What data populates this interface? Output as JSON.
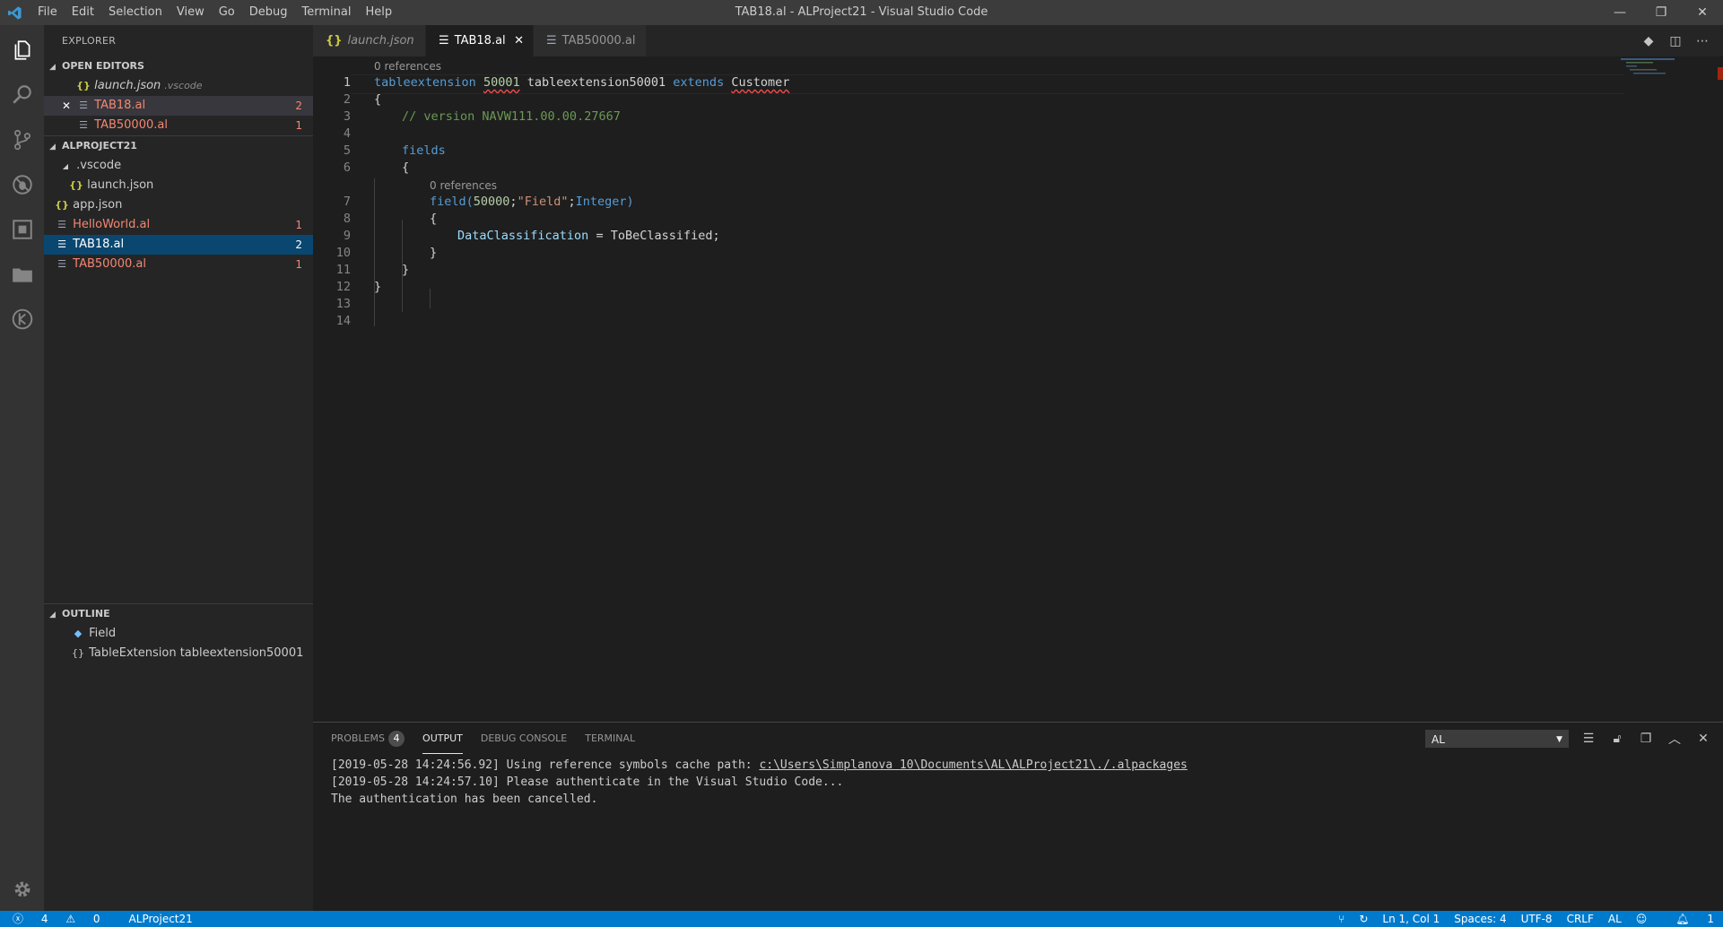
{
  "window": {
    "title": "TAB18.al - ALProject21 - Visual Studio Code",
    "menu": [
      "File",
      "Edit",
      "Selection",
      "View",
      "Go",
      "Debug",
      "Terminal",
      "Help"
    ],
    "controls": [
      "—",
      "❐",
      "✕"
    ]
  },
  "activity": [
    "files-icon",
    "search-icon",
    "source-control-icon",
    "debug-icon",
    "extensions-icon",
    "folder-icon",
    "al-explorer-icon",
    "gear-icon"
  ],
  "sidebar": {
    "title": "EXPLORER",
    "open_editors_label": "OPEN EDITORS",
    "open_editors": [
      {
        "name": "launch.json",
        "detail": ".vscode",
        "badge": ""
      },
      {
        "name": "TAB18.al",
        "detail": "",
        "badge": "2"
      },
      {
        "name": "TAB50000.al",
        "detail": "",
        "badge": "1"
      }
    ],
    "project_label": "ALPROJECT21",
    "tree": [
      {
        "name": ".vscode",
        "badge": ""
      },
      {
        "name": "launch.json",
        "badge": ""
      },
      {
        "name": "app.json",
        "badge": ""
      },
      {
        "name": "HelloWorld.al",
        "badge": "1"
      },
      {
        "name": "TAB18.al",
        "badge": "2"
      },
      {
        "name": "TAB50000.al",
        "badge": "1"
      }
    ],
    "outline_label": "OUTLINE",
    "outline": [
      {
        "name": "Field"
      },
      {
        "name": "TableExtension tableextension50001"
      }
    ]
  },
  "tabs": [
    {
      "label": "launch.json"
    },
    {
      "label": "TAB18.al"
    },
    {
      "label": "TAB50000.al"
    }
  ],
  "editor": {
    "line_numbers": [
      "1",
      "2",
      "3",
      "4",
      "5",
      "6",
      "7",
      "8",
      "9",
      "10",
      "11",
      "12",
      "13",
      "14"
    ],
    "codelens": "0 references",
    "code": {
      "l1_kw": "tableextension",
      "l1_num": "50001",
      "l1_name": "tableextension50001",
      "l1_extends": "extends",
      "l1_target": "Customer",
      "open_brace": "{",
      "close_brace": "}",
      "l3_comment": "// version NAVW111.00.00.27667",
      "l5_fields": "fields",
      "l7_field": "field(",
      "l7_num": "50000",
      "l7_sep": ";",
      "l7_str": "\"Field\"",
      "l7_type": "Integer",
      "l7_close": ")",
      "l9_prop": "DataClassification",
      "l9_eq": " = ",
      "l9_val": "ToBeClassified;"
    }
  },
  "panel": {
    "tabs": [
      "PROBLEMS",
      "OUTPUT",
      "DEBUG CONSOLE",
      "TERMINAL"
    ],
    "problems_count": "4",
    "channel": "AL",
    "output": {
      "l1_prefix": "[2019-05-28 14:24:56.92] Using reference symbols cache path: ",
      "l1_path": "c:\\Users\\Simplanova 10\\Documents\\AL\\ALProject21\\./.alpackages",
      "l2": "[2019-05-28 14:24:57.10] Please authenticate in the Visual Studio Code...",
      "l3": "The authentication has been cancelled."
    }
  },
  "status": {
    "errors": "4",
    "warnings": "0",
    "project": "ALProject21",
    "position": "Ln 1, Col 1",
    "spaces": "Spaces: 4",
    "encoding": "UTF-8",
    "eol": "CRLF",
    "language": "AL",
    "notifications": "1"
  }
}
